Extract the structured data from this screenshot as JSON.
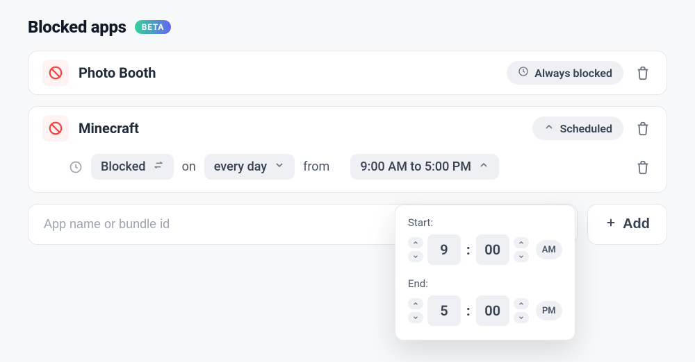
{
  "header": {
    "title": "Blocked apps",
    "badge": "BETA"
  },
  "apps": [
    {
      "name": "Photo Booth",
      "status_label": "Always blocked",
      "status_icon": "clock"
    },
    {
      "name": "Minecraft",
      "status_label": "Scheduled",
      "status_icon": "chevron-up",
      "schedule": {
        "mode_label": "Blocked",
        "on_label": "on",
        "days_label": "every day",
        "from_label": "from",
        "range_label": "9:00 AM to 5:00 PM"
      }
    }
  ],
  "add": {
    "placeholder": "App name or bundle id",
    "button_label": "Add"
  },
  "time_picker": {
    "start_label": "Start:",
    "end_label": "End:",
    "start": {
      "hour": "9",
      "minute": "00",
      "ampm": "AM"
    },
    "end": {
      "hour": "5",
      "minute": "00",
      "ampm": "PM"
    }
  }
}
